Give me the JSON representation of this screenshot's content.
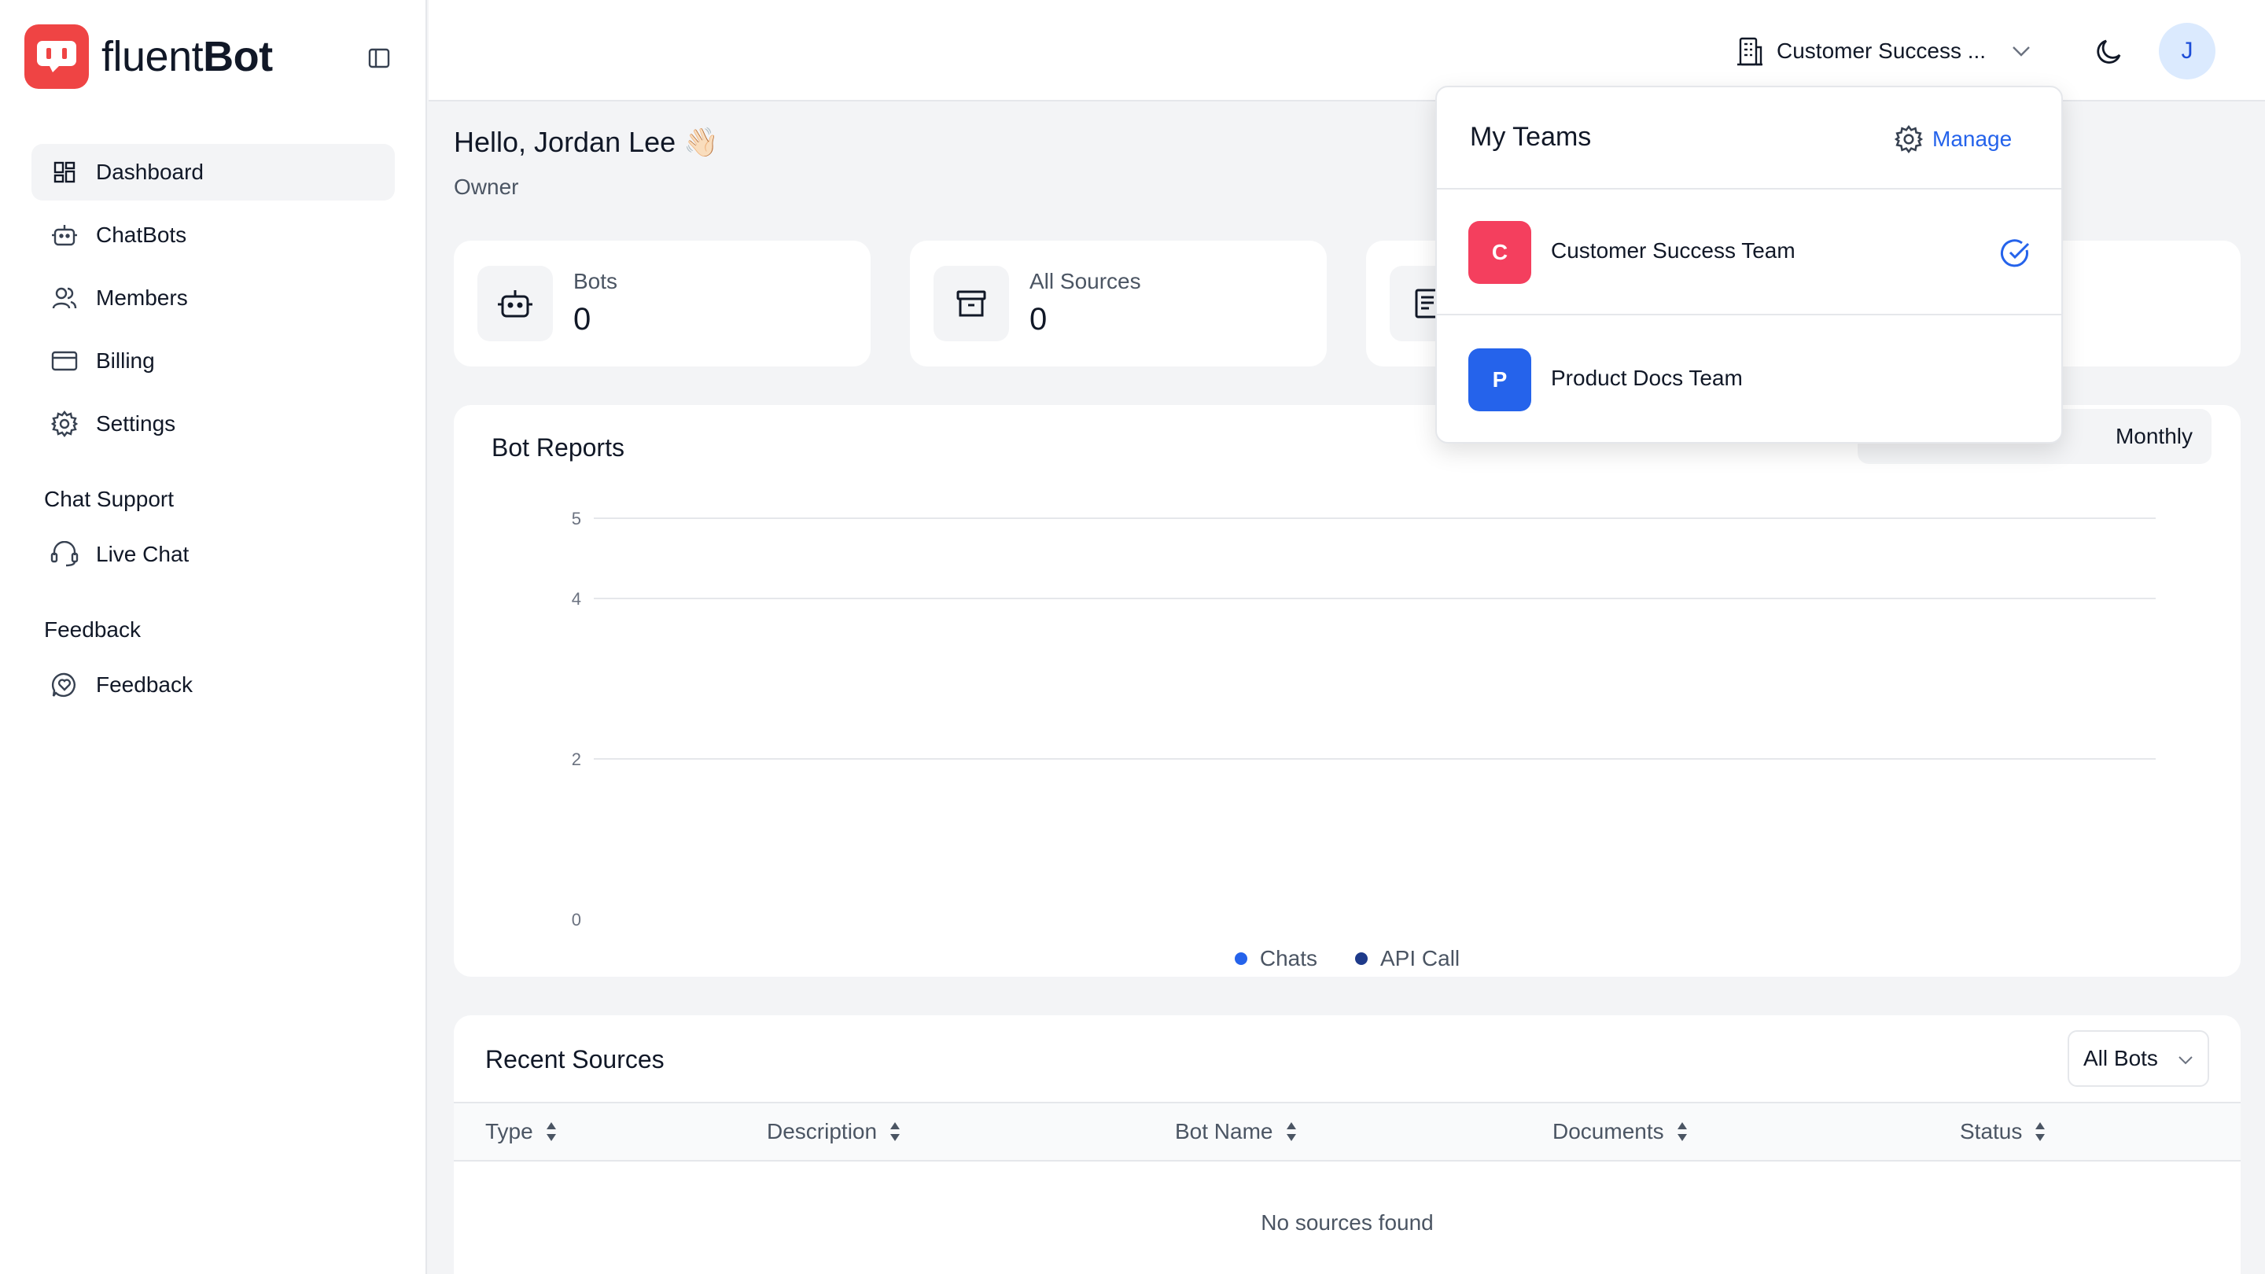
{
  "brand": {
    "logo_light": "fluent",
    "logo_bold": "Bot",
    "accent_color": "#ef4444"
  },
  "sidebar": {
    "items": [
      {
        "label": "Dashboard",
        "icon": "dashboard-icon",
        "active": true
      },
      {
        "label": "ChatBots",
        "icon": "robot-icon"
      },
      {
        "label": "Members",
        "icon": "users-icon"
      },
      {
        "label": "Billing",
        "icon": "credit-card-icon"
      },
      {
        "label": "Settings",
        "icon": "gear-icon"
      }
    ],
    "sections": [
      {
        "title": "Chat Support",
        "items": [
          {
            "label": "Live Chat",
            "icon": "headset-icon"
          }
        ]
      },
      {
        "title": "Feedback",
        "items": [
          {
            "label": "Feedback",
            "icon": "message-heart-icon"
          }
        ]
      }
    ]
  },
  "topbar": {
    "team_label": "Customer Success ...",
    "avatar_initial": "J"
  },
  "greeting": {
    "text": "Hello, Jordan Lee",
    "emoji": "👋🏻",
    "role": "Owner"
  },
  "stats": [
    {
      "label": "Bots",
      "value": "0",
      "icon": "robot-icon"
    },
    {
      "label": "All Sources",
      "value": "0",
      "icon": "archive-icon"
    },
    {
      "label": "",
      "value": "",
      "icon": "document-icon"
    }
  ],
  "chart": {
    "title": "Bot Reports",
    "periods": [
      "Monthly"
    ],
    "active_period": "Monthly"
  },
  "chart_data": {
    "type": "line",
    "y_ticks": [
      "5",
      "4",
      "2",
      "0"
    ],
    "ylim": [
      0,
      5
    ],
    "series": [
      {
        "name": "Chats",
        "values": [],
        "color": "#2563eb"
      },
      {
        "name": "API Call",
        "values": [],
        "color": "#1e3a8a"
      }
    ],
    "grid": true,
    "legend": "bottom-center"
  },
  "sources": {
    "title": "Recent Sources",
    "filter_value": "All Bots",
    "columns": [
      "Type",
      "Description",
      "Bot Name",
      "Documents",
      "Status"
    ],
    "empty_text": "No sources found"
  },
  "teams_dropdown": {
    "title": "My Teams",
    "manage_label": "Manage",
    "teams": [
      {
        "initial": "C",
        "name": "Customer Success Team",
        "color": "#f43f5e",
        "selected": true
      },
      {
        "initial": "P",
        "name": "Product Docs Team",
        "color": "#2563eb",
        "selected": false
      }
    ]
  }
}
